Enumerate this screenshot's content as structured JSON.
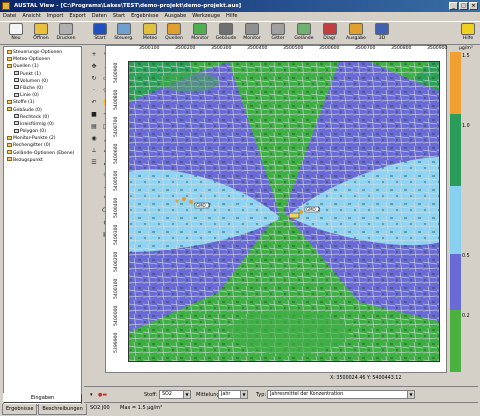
{
  "window": {
    "title": "AUSTAL View - [C:\\Programs\\Lakes\\TEST\\demo-projekt\\demo-projekt.aus]"
  },
  "menu": [
    "Datei",
    "Ansicht",
    "Import",
    "Export",
    "Daten",
    "Start",
    "Ergebnisse",
    "Ausgabe",
    "Werkzeuge",
    "Hilfe"
  ],
  "toolbar": [
    {
      "label": "Neu",
      "icon": "new-file-icon",
      "color": "#f4f4f4"
    },
    {
      "label": "Öffnen",
      "icon": "open-folder-icon",
      "color": "#e8c040"
    },
    {
      "label": "Drucken",
      "icon": "printer-icon",
      "color": "#b0b0b0"
    },
    {
      "label": "Start",
      "icon": "start-arrow-icon",
      "color": "#2050c0"
    },
    {
      "label": "Steuerg.",
      "icon": "settings-icon",
      "color": "#70a0d0"
    },
    {
      "label": "Meteo",
      "icon": "meteo-icon",
      "color": "#e0c040"
    },
    {
      "label": "Quellen",
      "icon": "sources-icon",
      "color": "#e0a030"
    },
    {
      "label": "Monitor",
      "icon": "monitor-icon",
      "color": "#50b050"
    },
    {
      "label": "Gebäude",
      "icon": "building-icon",
      "color": "#707070"
    },
    {
      "label": "Monitor",
      "icon": "monitor-point-icon",
      "color": "#909090"
    },
    {
      "label": "Gitter",
      "icon": "grid-icon",
      "color": "#a0a0a0"
    },
    {
      "label": "Gelände",
      "icon": "terrain-icon",
      "color": "#70b070"
    },
    {
      "label": "Diagr.",
      "icon": "diagram-icon",
      "color": "#c04040"
    },
    {
      "label": "Ausgabe",
      "icon": "output-icon",
      "color": "#e0a030"
    },
    {
      "label": "3D",
      "icon": "3d-icon",
      "color": "#4060b0"
    },
    {
      "label": "Hilfe",
      "icon": "help-icon",
      "color": "#f0d020"
    }
  ],
  "tree": [
    {
      "label": "Steuerungs-Optionen",
      "level": 0
    },
    {
      "label": "Meteo-Optionen",
      "level": 0
    },
    {
      "label": "Quellen (1)",
      "level": 0
    },
    {
      "label": "Punkt (1)",
      "level": 1
    },
    {
      "label": "Volumen (0)",
      "level": 1
    },
    {
      "label": "Fläche (0)",
      "level": 1
    },
    {
      "label": "Linie (0)",
      "level": 1
    },
    {
      "label": "Stoffe (1)",
      "level": 0
    },
    {
      "label": "Gebäude (0)",
      "level": 0
    },
    {
      "label": "Rechteck (0)",
      "level": 1
    },
    {
      "label": "kreisförmig (0)",
      "level": 1
    },
    {
      "label": "Polygon (0)",
      "level": 1
    },
    {
      "label": "Monitor-Punkte (2)",
      "level": 0
    },
    {
      "label": "Rechengitter (0)",
      "level": 0
    },
    {
      "label": "Gelände-Optionen (Ebene)",
      "level": 0
    },
    {
      "label": "Bezugspunkt",
      "level": 0
    }
  ],
  "left_button": "Eingaben",
  "tabs": [
    "Ergebnisse",
    "Beschreibungen"
  ],
  "axis": {
    "x_ticks": [
      "3500100",
      "3500200",
      "3500300",
      "3500400",
      "3500500",
      "3500600",
      "3500700",
      "3500800",
      "3500900"
    ],
    "y_ticks": [
      "5400900",
      "5400800",
      "5400700",
      "5400600",
      "5400500",
      "5400400",
      "5400300",
      "5400200",
      "5400100",
      "5400000",
      "5399900"
    ]
  },
  "map": {
    "source_label": "Q1",
    "monitor_label": "GMO_1",
    "source_label2": "Q2",
    "monitor_label2": "GMO_2"
  },
  "legend": {
    "unit": "µg/m³",
    "ticks": [
      "1.5",
      "1.0",
      "0.5",
      "0.2"
    ],
    "colors": [
      "#f0a030",
      "#2a9d5a",
      "#87d0f0",
      "#7070d8",
      "#4ab040"
    ]
  },
  "coords": "X: 3500024.46   Y: 5400443.12",
  "bottom": {
    "stoff_label": "Stoff:",
    "stoff_value": "SO2",
    "mittelung_label": "Mittelung:",
    "mittelung_value": "Jahr",
    "typ_label": "Typ:",
    "typ_value": "Jahresmittel der Konzentration"
  },
  "status": {
    "left": "SO2 J00",
    "right": "Max = 1.5 µg/m³"
  }
}
